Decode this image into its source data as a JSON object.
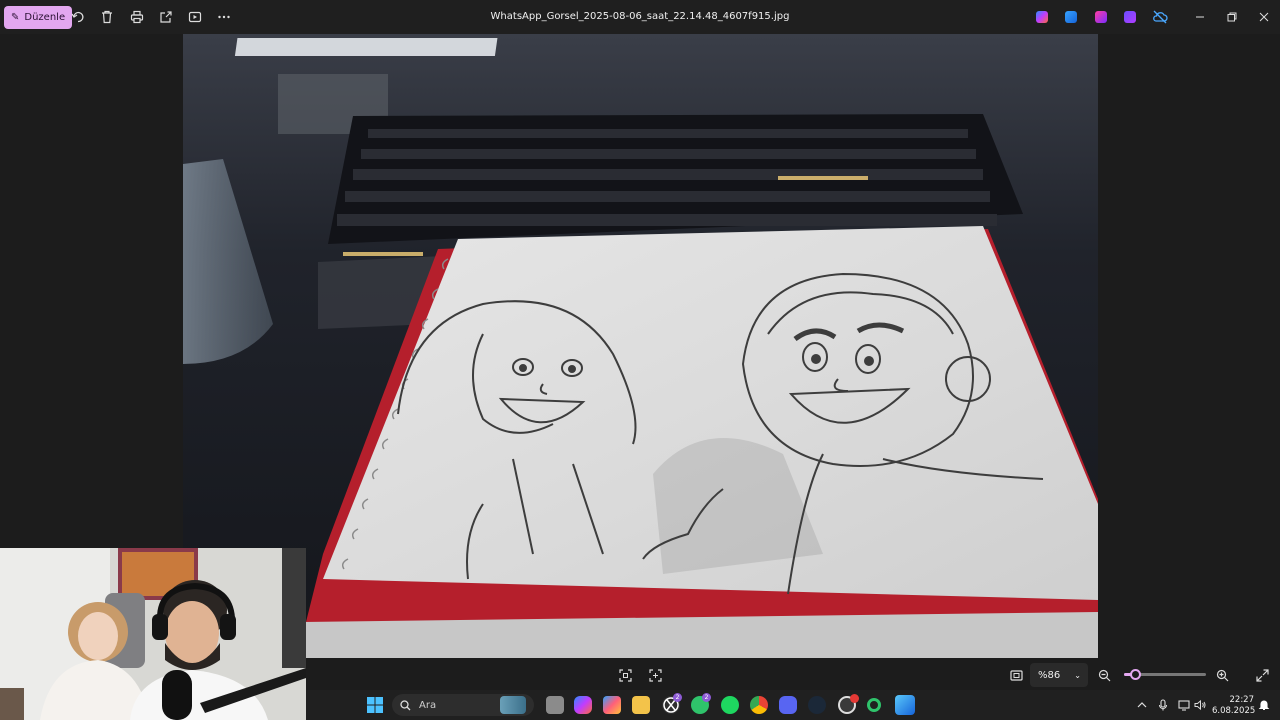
{
  "toolbar": {
    "edit_label": "Düzenle",
    "filename": "WhatsApp_Gorsel_2025-08-06_saat_22.14.48_4607f915.jpg"
  },
  "viewer": {
    "zoom_value": "%86",
    "zoom_level": 0.14
  },
  "taskbar": {
    "search_placeholder": "Ara",
    "badges": {
      "xbox": "2",
      "whatsapp": "2"
    },
    "time": "22:27",
    "date": "6.08.2025"
  },
  "colors": {
    "accent": "#e3a7f0",
    "titlebar": "#1f1f1f",
    "taskbar": "#202020",
    "notebook_red": "#b51f2c",
    "paper": "#dedede"
  }
}
